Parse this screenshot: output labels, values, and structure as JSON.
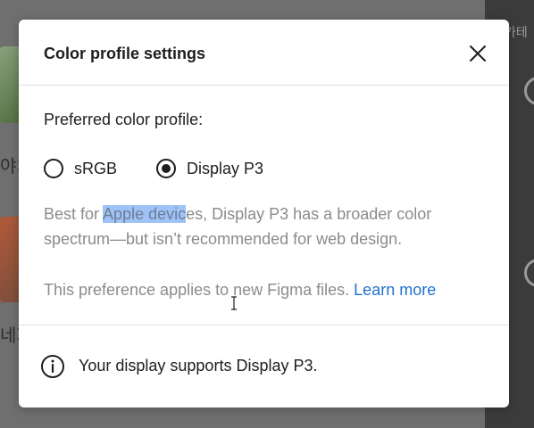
{
  "background": {
    "right_panel_text": "가테",
    "left_text_1": "야치",
    "left_text_2": "네지"
  },
  "dialog": {
    "title": "Color profile settings",
    "close_icon": "close-icon",
    "preferred_label": "Preferred color profile:",
    "options": [
      {
        "label": "sRGB",
        "selected": false
      },
      {
        "label": "Display P3",
        "selected": true
      }
    ],
    "description": {
      "before": "Best for ",
      "highlighted": "Apple devic",
      "after": "es, Display P3 has a broader color spectrum—but isn’t recommended for web design."
    },
    "note": {
      "text": "This preference applies to new Figma files. ",
      "link": "Learn more"
    },
    "footer": {
      "icon": "info-icon",
      "text": "Your display supports Display P3."
    }
  },
  "colors": {
    "link": "#1f72c9",
    "selection_highlight": "#9fc3f7",
    "text": "#1e1e1e",
    "muted_text": "#8b8b8b"
  }
}
